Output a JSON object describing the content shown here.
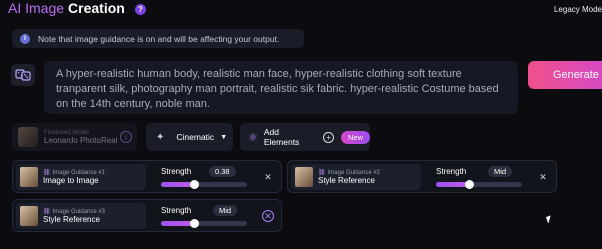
{
  "header": {
    "title_accent": "AI Image",
    "title_main": "Creation",
    "help_icon": "question-icon",
    "legacy_label": "Legacy Mode"
  },
  "note": {
    "icon": "info-icon",
    "text": "Note that image guidance is on and will be affecting your output."
  },
  "prompt": {
    "dice_icon": "dice-icon",
    "text": "A hyper-realistic human body, realistic man face, hyper-realistic clothing soft texture tranparent silk, photography man portrait, realistic sik fabric. hyper-realistic Costume based on the 14th century, noble man."
  },
  "generate_label": "Generate",
  "toolbar": {
    "model_label": "Finetuned Model",
    "model_name": "Leonardo PhotoReal",
    "style_label": "Cinematic",
    "add_elements_label": "Add Elements",
    "new_badge": "New"
  },
  "guidance": [
    {
      "label": "Image Guidance #1",
      "type": "Image to Image",
      "strength_label": "Strength",
      "value": "0.38",
      "level": 0.38,
      "close_style": "plain"
    },
    {
      "label": "Image Guidance #2",
      "type": "Style Reference",
      "strength_label": "Strength",
      "value": "Mid",
      "level": 0.38,
      "close_style": "plain"
    },
    {
      "label": "Image Guidance #3",
      "type": "Style Reference",
      "strength_label": "Strength",
      "value": "Mid",
      "level": 0.38,
      "close_style": "ring"
    }
  ],
  "colors": {
    "accent_purple": "#b86cf0",
    "generate_gradient_start": "#f0508a",
    "generate_gradient_end": "#d44ac8",
    "background": "#0b0b10"
  }
}
